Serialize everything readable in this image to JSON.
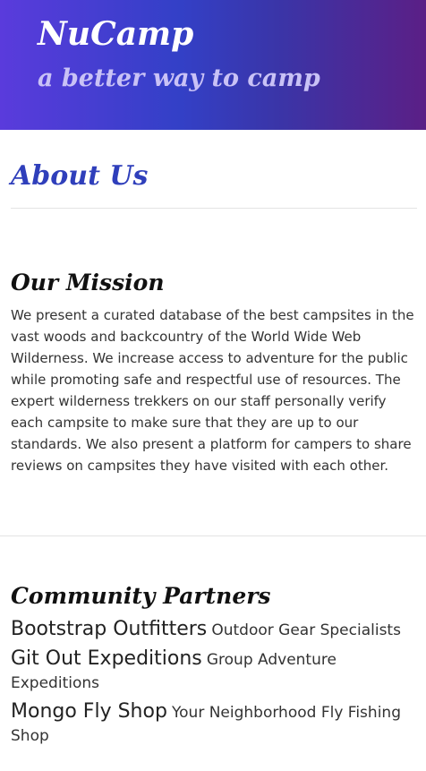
{
  "header": {
    "brand": "NuCamp",
    "tagline": "a better way to camp"
  },
  "page": {
    "title": "About Us"
  },
  "mission": {
    "title": "Our Mission",
    "text": "We present a curated database of the best campsites in the vast woods and backcountry of the World Wide Web Wilderness. We increase access to adventure for the public while promoting safe and respectful use of resources. The expert wilderness trekkers on our staff personally verify each campsite to make sure that they are up to our standards. We also present a platform for campers to share reviews on campsites they have visited with each other."
  },
  "partners": {
    "title": "Community Partners",
    "items": [
      {
        "name": "Bootstrap Outfitters",
        "description": "Outdoor Gear Specialists"
      },
      {
        "name": "Git Out Expeditions",
        "description": "Group Adventure Expeditions"
      },
      {
        "name": "Mongo Fly Shop",
        "description": "Your Neighborhood Fly Fishing Shop"
      }
    ]
  },
  "colors": {
    "header_gradient_start": "#5a3bdc",
    "header_gradient_mid": "#3340c7",
    "header_gradient_end": "#5b1f86",
    "page_title": "#2f3fbb",
    "tagline": "#c9c2f6"
  }
}
